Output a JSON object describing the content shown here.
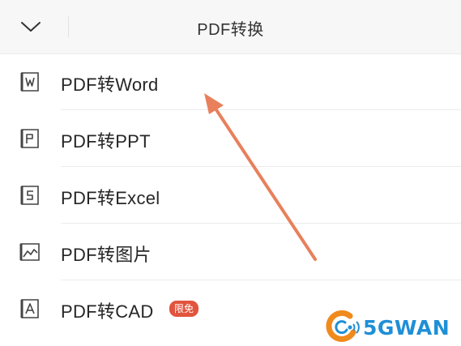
{
  "header": {
    "title": "PDF转换",
    "back_icon": "chevron-down-icon"
  },
  "items": [
    {
      "label": "PDF转Word",
      "icon": "word-doc-icon"
    },
    {
      "label": "PDF转PPT",
      "icon": "ppt-doc-icon"
    },
    {
      "label": "PDF转Excel",
      "icon": "excel-doc-icon"
    },
    {
      "label": "PDF转图片",
      "icon": "image-chart-icon"
    },
    {
      "label": "PDF转CAD",
      "icon": "cad-doc-icon",
      "badge": "限免"
    }
  ],
  "watermark": {
    "text": "5GWAN"
  },
  "colors": {
    "annotation_arrow": "#e8805c",
    "badge": "#e2543d",
    "watermark_blue": "#1f8fd6",
    "watermark_orange": "#f08a1c"
  }
}
